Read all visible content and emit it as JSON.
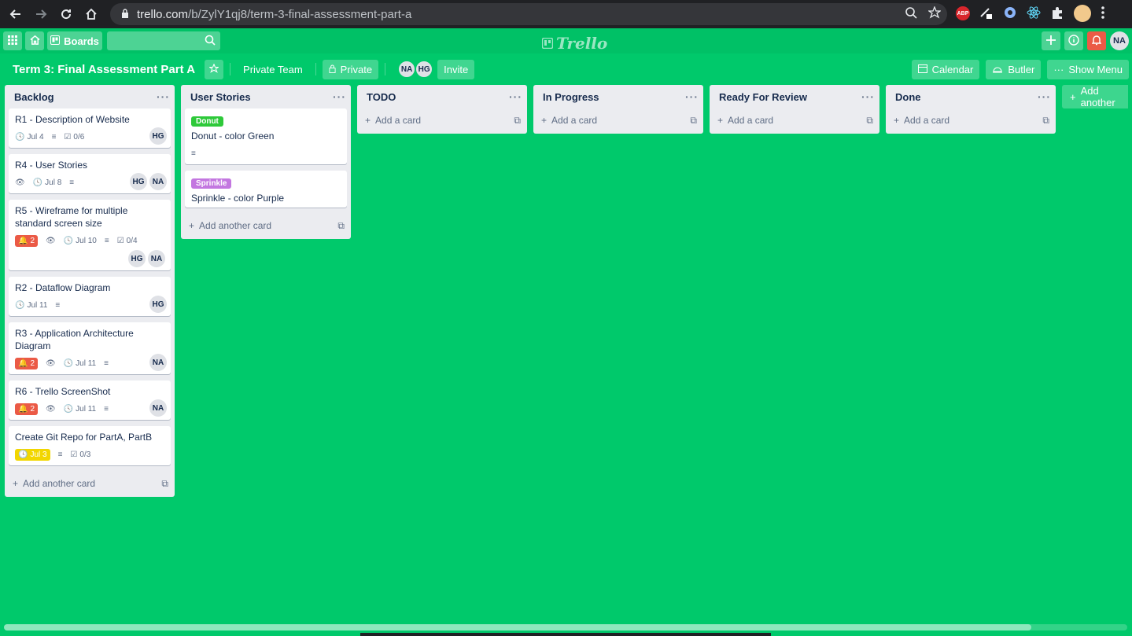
{
  "browser": {
    "url_host": "trello.com",
    "url_path": "/b/ZylY1qj8/term-3-final-assessment-part-a",
    "extensions": [
      "ABP"
    ]
  },
  "header": {
    "boards_label": "Boards",
    "logo_text": "Trello",
    "user_initials": "NA"
  },
  "board": {
    "title": "Term 3: Final Assessment Part A",
    "team_label": "Private Team",
    "visibility_label": "Private",
    "members": [
      "NA",
      "HG"
    ],
    "invite_label": "Invite",
    "calendar_label": "Calendar",
    "butler_label": "Butler",
    "show_menu_label": "Show Menu"
  },
  "lists": [
    {
      "title": "Backlog",
      "add_label": "Add another card",
      "cards": [
        {
          "title": "R1 - Description of Website",
          "due": "Jul 4",
          "checklist": "0/6",
          "members": [
            "HG"
          ]
        },
        {
          "title": "R4 - User Stories",
          "due": "Jul 8",
          "members": [
            "HG",
            "NA"
          ]
        },
        {
          "title": "R5 - Wireframe for multiple standard screen size",
          "alerts": "2",
          "due": "Jul 10",
          "checklist": "0/4",
          "members": [
            "HG",
            "NA"
          ]
        },
        {
          "title": "R2 - Dataflow Diagram",
          "due": "Jul 11",
          "members": [
            "HG"
          ]
        },
        {
          "title": "R3 - Application Architecture Diagram",
          "alerts": "2",
          "due": "Jul 11",
          "members": [
            "NA"
          ]
        },
        {
          "title": "R6 - Trello ScreenShot",
          "alerts": "2",
          "due": "Jul 11",
          "members": [
            "NA"
          ]
        },
        {
          "title": "Create Git Repo for PartA, PartB",
          "due": "Jul 3",
          "checklist": "0/3"
        }
      ]
    },
    {
      "title": "User Stories",
      "add_label": "Add another card",
      "cards": [
        {
          "label": "Donut",
          "title": "Donut - color Green"
        },
        {
          "label": "Sprinkle",
          "title": "Sprinkle - color Purple"
        }
      ]
    },
    {
      "title": "TODO",
      "add_label": "Add a card"
    },
    {
      "title": "In Progress",
      "add_label": "Add a card"
    },
    {
      "title": "Ready For Review",
      "add_label": "Add a card"
    },
    {
      "title": "Done",
      "add_label": "Add a card"
    }
  ],
  "add_list_label": "Add another",
  "colors": {
    "board_bg": "#00c96b",
    "label_donut": "#2ec93a",
    "label_sprinkle": "#c377e0",
    "alert_red": "#eb5a46",
    "due_yellow": "#f2d600"
  }
}
